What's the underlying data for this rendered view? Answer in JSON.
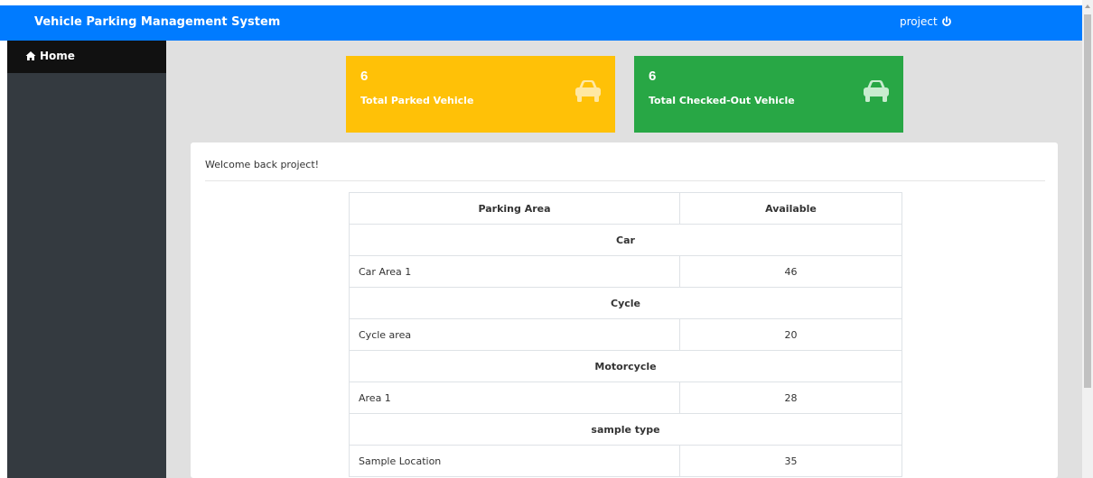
{
  "header": {
    "brand": "Vehicle Parking Management System",
    "user": "project"
  },
  "sidebar": {
    "items": [
      {
        "label": "Home"
      }
    ]
  },
  "cards": [
    {
      "count": "6",
      "label": "Total Parked Vehicle",
      "color": "#ffc107",
      "icon": "car-icon"
    },
    {
      "count": "6",
      "label": "Total Checked-Out Vehicle",
      "color": "#28a745",
      "icon": "car-icon"
    }
  ],
  "panel": {
    "welcome": "Welcome back project!"
  },
  "table": {
    "headers": [
      "Parking Area",
      "Available"
    ],
    "groups": [
      {
        "type": "Car",
        "rows": [
          {
            "area": "Car Area 1",
            "available": "46"
          }
        ]
      },
      {
        "type": "Cycle",
        "rows": [
          {
            "area": "Cycle area",
            "available": "20"
          }
        ]
      },
      {
        "type": "Motorcycle",
        "rows": [
          {
            "area": "Area 1",
            "available": "28"
          }
        ]
      },
      {
        "type": "sample type",
        "rows": [
          {
            "area": "Sample Location",
            "available": "35"
          }
        ]
      }
    ]
  },
  "colors": {
    "topbar": "#007bff",
    "sidebar": "#343a40",
    "sidebar_active": "#111111"
  }
}
